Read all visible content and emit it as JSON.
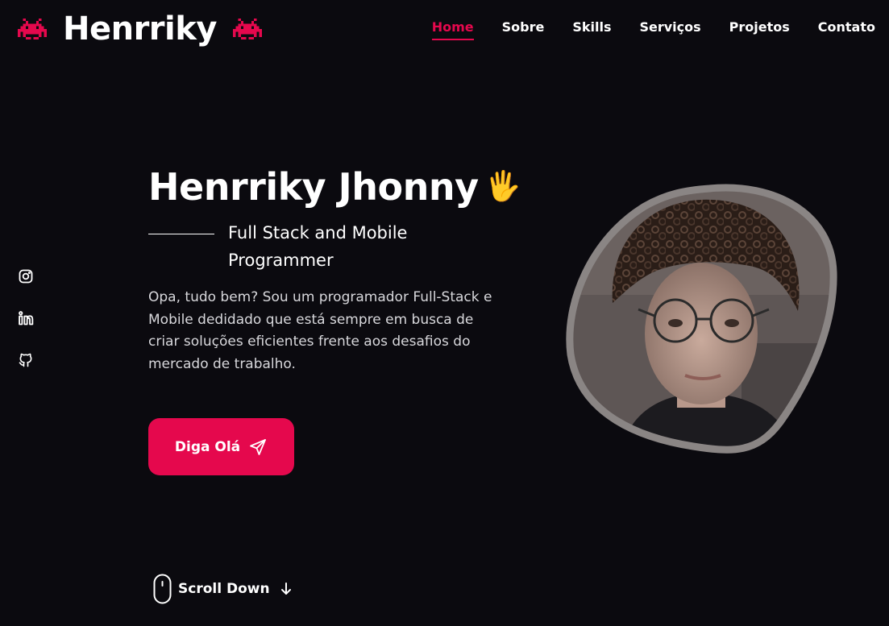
{
  "brand": {
    "name": "Henrriky",
    "icon_left": "space-invader-icon",
    "icon_right": "space-invader-icon",
    "accent_color": "#e5084d"
  },
  "nav": {
    "items": [
      {
        "label": "Home",
        "active": true
      },
      {
        "label": "Sobre",
        "active": false
      },
      {
        "label": "Skills",
        "active": false
      },
      {
        "label": "Serviços",
        "active": false
      },
      {
        "label": "Projetos",
        "active": false
      },
      {
        "label": "Contato",
        "active": false
      }
    ]
  },
  "social": {
    "icons": [
      "instagram-icon",
      "linkedin-icon",
      "github-icon"
    ]
  },
  "hero": {
    "title": "Henrriky Jhonny",
    "wave": "🖐",
    "subtitle": "Full Stack and Mobile Programmer",
    "description": "Opa, tudo bem? Sou um programador Full-Stack e Mobile dedidado que está sempre em busca de criar soluções eficientes frente aos desafios do mercado de trabalho.",
    "cta_label": "Diga Olá",
    "cta_icon": "send-icon"
  },
  "scroll": {
    "label": "Scroll Down",
    "icon": "mouse-icon"
  },
  "colors": {
    "background": "#0b0a0f",
    "accent": "#e5084d",
    "text": "#ffffff"
  }
}
